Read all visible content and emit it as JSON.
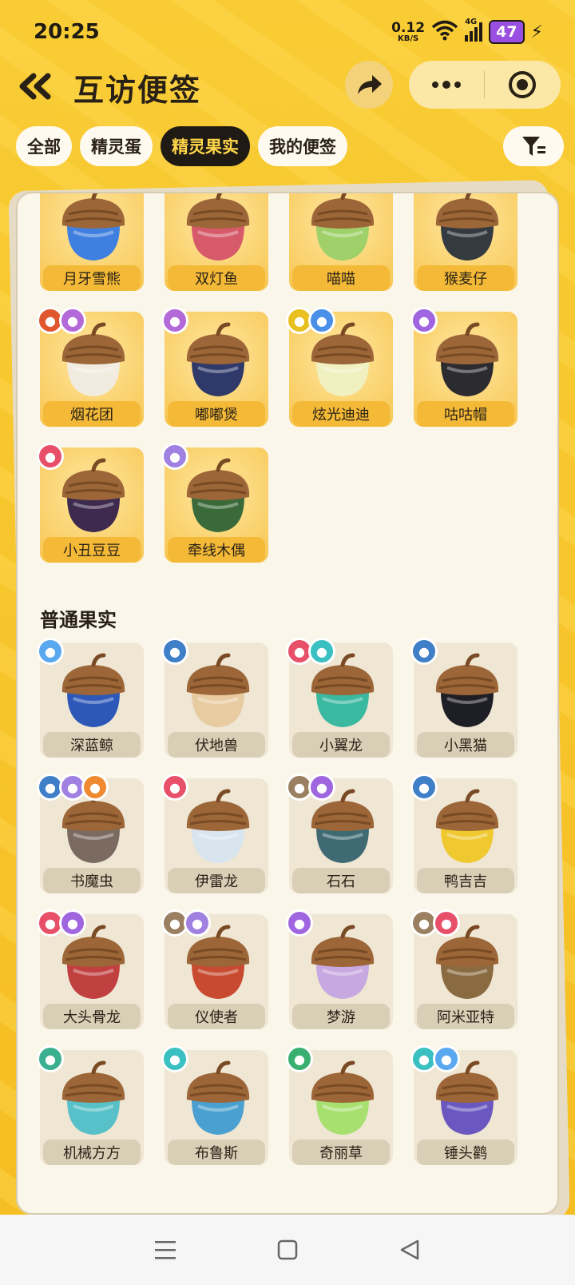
{
  "status": {
    "time": "20:25",
    "net_speed": "0.12",
    "net_unit": "KB/S",
    "battery": "47",
    "signal_label": "4G"
  },
  "header": {
    "title": "互访便签"
  },
  "tabs": [
    {
      "label": "全部",
      "active": false
    },
    {
      "label": "精灵蛋",
      "active": false
    },
    {
      "label": "精灵果实",
      "active": true
    },
    {
      "label": "我的便签",
      "active": false
    }
  ],
  "rare_items": [
    {
      "name": "月牙雪熊",
      "color": "#3f7fe0",
      "badges": []
    },
    {
      "name": "双灯鱼",
      "color": "#d65a6a",
      "badges": []
    },
    {
      "name": "喵喵",
      "color": "#9fd06a",
      "badges": []
    },
    {
      "name": "猴麦仔",
      "color": "#333a40",
      "badges": []
    },
    {
      "name": "烟花团",
      "color": "#f2ece0",
      "badges": [
        "#e0562f",
        "#b36ad8"
      ]
    },
    {
      "name": "嘟嘟煲",
      "color": "#2f3a6a",
      "badges": [
        "#b36ad8"
      ]
    },
    {
      "name": "炫光迪迪",
      "color": "#f0f0c0",
      "badges": [
        "#e8c020",
        "#4a90e8"
      ]
    },
    {
      "name": "咕咕帽",
      "color": "#2c2c30",
      "badges": [
        "#a066e0"
      ]
    },
    {
      "name": "小丑豆豆",
      "color": "#3d2a4e",
      "badges": [
        "#e8506a"
      ]
    },
    {
      "name": "牵线木偶",
      "color": "#3b6a3a",
      "badges": [
        "#a080e0"
      ]
    }
  ],
  "section_title": "普通果实",
  "normal_items": [
    {
      "name": "深蓝鲸",
      "color": "#2e58b8",
      "badges": [
        "#5aa8f0"
      ]
    },
    {
      "name": "伏地兽",
      "color": "#e8cba0",
      "badges": [
        "#3f7fc8"
      ]
    },
    {
      "name": "小翼龙",
      "color": "#3ab8a0",
      "badges": [
        "#e8506a",
        "#3ac0c0"
      ]
    },
    {
      "name": "小黑猫",
      "color": "#1e1e26",
      "badges": [
        "#3f7fc8"
      ]
    },
    {
      "name": "书魔虫",
      "color": "#7a6a60",
      "badges": [
        "#3f7fc8",
        "#a080e0",
        "#f08a30"
      ]
    },
    {
      "name": "伊雷龙",
      "color": "#d8e4ee",
      "badges": [
        "#e8506a"
      ]
    },
    {
      "name": "石石",
      "color": "#3f6a74",
      "badges": [
        "#9a8060",
        "#a066e0"
      ]
    },
    {
      "name": "鸭吉吉",
      "color": "#f0c830",
      "badges": [
        "#3f7fc8"
      ]
    },
    {
      "name": "大头骨龙",
      "color": "#c04040",
      "badges": [
        "#e8506a",
        "#a066e0"
      ]
    },
    {
      "name": "仪使者",
      "color": "#c84a30",
      "badges": [
        "#9a8060",
        "#a080e0"
      ]
    },
    {
      "name": "梦游",
      "color": "#c8a8e0",
      "badges": [
        "#a066e0"
      ]
    },
    {
      "name": "阿米亚特",
      "color": "#8a6a40",
      "badges": [
        "#9a8060",
        "#e8506a"
      ]
    },
    {
      "name": "机械方方",
      "color": "#58c0c8",
      "badges": [
        "#3ab090"
      ]
    },
    {
      "name": "布鲁斯",
      "color": "#4aa0d0",
      "badges": [
        "#3ac0c0"
      ]
    },
    {
      "name": "奇丽草",
      "color": "#a8e070",
      "badges": [
        "#3ab070"
      ]
    },
    {
      "name": "锤头鹳",
      "color": "#6a58c0",
      "badges": [
        "#3ac0c0",
        "#5aa8f0"
      ]
    }
  ]
}
